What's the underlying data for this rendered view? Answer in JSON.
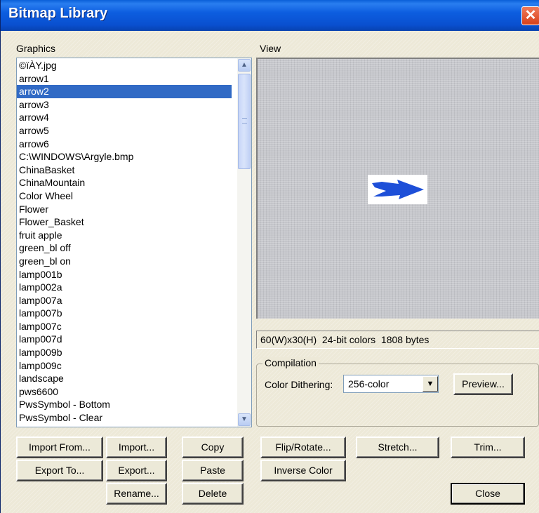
{
  "window": {
    "title": "Bitmap Library",
    "close_glyph": "✕"
  },
  "graphics": {
    "label": "Graphics",
    "selected_index": 2,
    "items": [
      "©ïÀY.jpg",
      "arrow1",
      "arrow2",
      "arrow3",
      "arrow4",
      "arrow5",
      "arrow6",
      "C:\\WINDOWS\\Argyle.bmp",
      "ChinaBasket",
      "ChinaMountain",
      "Color Wheel",
      "Flower",
      "Flower_Basket",
      "fruit apple",
      "green_bl off",
      "green_bl on",
      "lamp001b",
      "lamp002a",
      "lamp007a",
      "lamp007b",
      "lamp007c",
      "lamp007d",
      "lamp009b",
      "lamp009c",
      "landscape",
      "pws6600",
      "PwsSymbol - Bottom",
      "PwsSymbol - Clear"
    ],
    "scroll_up_icon": "▲",
    "scroll_down_icon": "▼"
  },
  "view": {
    "label": "View",
    "info": "60(W)x30(H)  24-bit colors  1808 bytes",
    "preview_arrow_color": "#1d4fd8"
  },
  "compilation": {
    "label": "Compilation",
    "dithering_label": "Color Dithering:",
    "dithering_value": "256-color",
    "dropdown_icon": "▼",
    "preview_button": "Preview..."
  },
  "buttons": {
    "import_from": "Import From...",
    "import": "Import...",
    "copy": "Copy",
    "export_to": "Export To...",
    "export": "Export...",
    "paste": "Paste",
    "rename": "Rename...",
    "delete": "Delete",
    "flip_rotate": "Flip/Rotate...",
    "stretch": "Stretch...",
    "trim": "Trim...",
    "inverse_color": "Inverse Color",
    "close": "Close"
  }
}
